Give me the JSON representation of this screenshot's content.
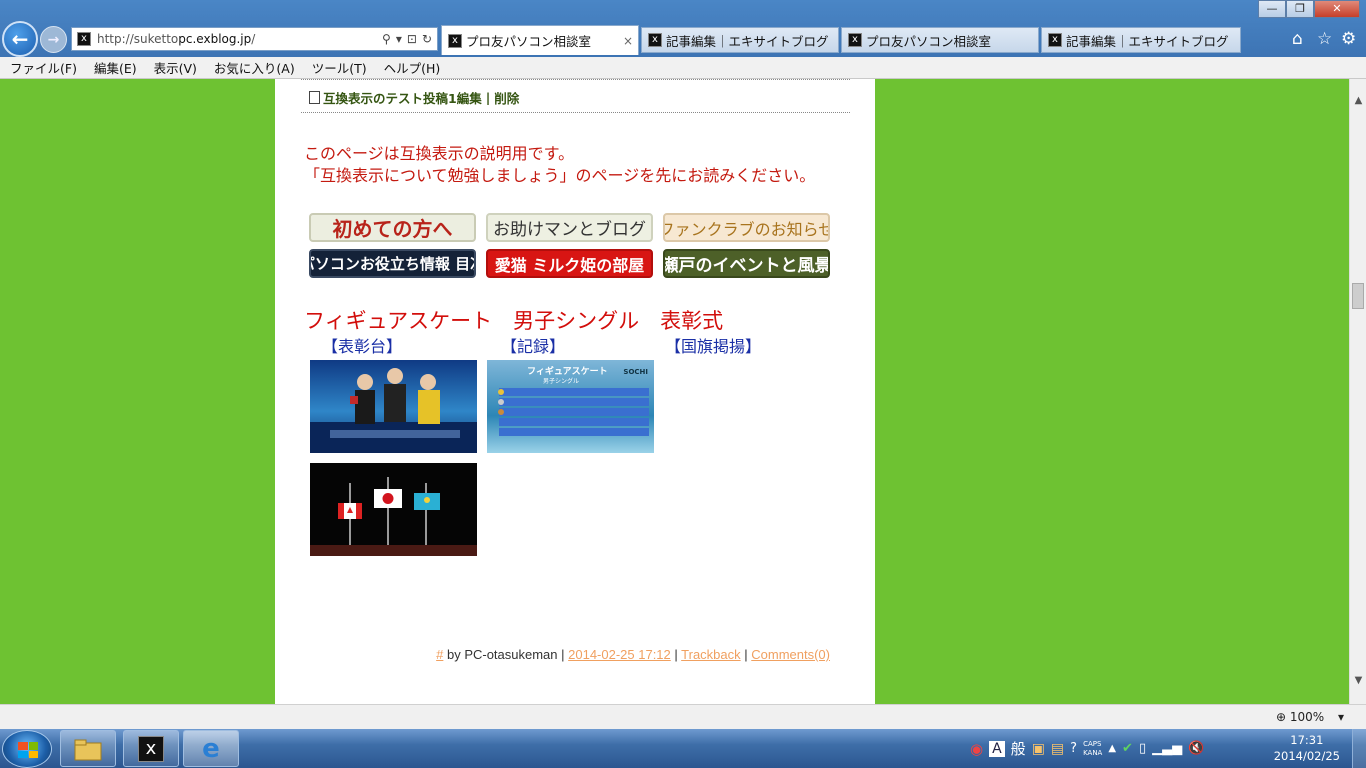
{
  "browser": {
    "url_prefix": "http://suketto",
    "url_host": "pc.exblog.jp",
    "url_suffix": "/",
    "tabs": [
      {
        "label": "プロ友パソコン相談室",
        "active": true,
        "close": "×"
      },
      {
        "label": "記事編集｜エキサイトブログ",
        "active": false
      },
      {
        "label": "プロ友パソコン相談室",
        "active": false
      },
      {
        "label": "記事編集｜エキサイトブログ",
        "active": false
      }
    ],
    "favicon_glyph": "x",
    "window_controls": {
      "minimize": "—",
      "restore": "❐",
      "close": "✕"
    }
  },
  "menu": [
    "ファイル(F)",
    "編集(E)",
    "表示(V)",
    "お気に入り(A)",
    "ツール(T)",
    "ヘルプ(H)"
  ],
  "post": {
    "related_link": "互換表示のテスト投稿1",
    "related_edit": "編集",
    "related_sep": "|",
    "related_delete": "削除",
    "notice_line1": "このページは互換表示の説明用です。",
    "notice_line2": "「互換表示について勉強しましょう」のページを先にお読みください。",
    "banners": [
      "初めての方へ",
      "お助けマンとブログ",
      "ファンクラブのお知らせ",
      "パソコンお役立ち情報 目次",
      "愛猫 ミルク姫の部屋",
      "瀬戸のイベントと風景"
    ],
    "title": "フィギュアスケート　男子シングル　表彰式",
    "captions": [
      "【表彰台】",
      "【記録】",
      "【国旗掲揚】"
    ],
    "photo2_overlay_title": "フィギュアスケート",
    "photo2_overlay_sub": "男子シングル",
    "photo2_logo": "SOCHI"
  },
  "footer": {
    "hash": "#",
    "by_text": " by PC-otasukeman | ",
    "date": "2014-02-25 17:12",
    "sep": " | ",
    "trackback": "Trackback",
    "comments": "Comments(0)"
  },
  "status": {
    "zoom": "100%"
  },
  "taskbar": {
    "ime_mode": "A",
    "ime_kanji": "般",
    "caps": "CAPS",
    "kana": "KANA",
    "time": "17:31",
    "date": "2014/02/25"
  }
}
